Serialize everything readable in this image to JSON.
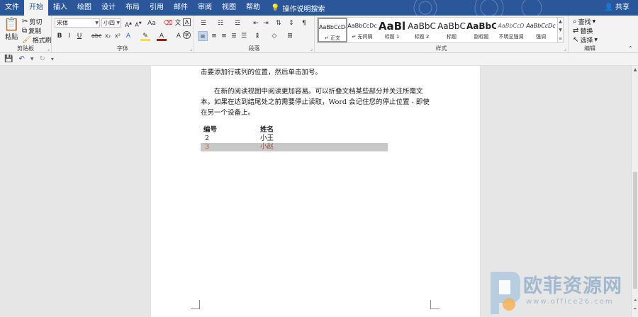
{
  "tabs": [
    {
      "label": "文件",
      "active": false
    },
    {
      "label": "开始",
      "active": true
    },
    {
      "label": "插入",
      "active": false
    },
    {
      "label": "绘图",
      "active": false
    },
    {
      "label": "设计",
      "active": false
    },
    {
      "label": "布局",
      "active": false
    },
    {
      "label": "引用",
      "active": false
    },
    {
      "label": "邮件",
      "active": false
    },
    {
      "label": "审阅",
      "active": false
    },
    {
      "label": "视图",
      "active": false
    },
    {
      "label": "帮助",
      "active": false
    }
  ],
  "tell_me": "操作说明搜索",
  "share": "共享",
  "clipboard": {
    "paste": "粘贴",
    "cut": "剪切",
    "copy": "复制",
    "format_painter": "格式刷",
    "label": "剪贴板"
  },
  "font": {
    "name": "宋体",
    "size": "小四",
    "label": "字体"
  },
  "paragraph": {
    "label": "段落"
  },
  "styles": {
    "label": "样式",
    "items": [
      {
        "preview": "AaBbCcDc",
        "name": "↵ 正文",
        "selected": true
      },
      {
        "preview": "AaBbCcDc",
        "name": "↵ 无间隔",
        "selected": false
      },
      {
        "preview": "AaBl",
        "name": "标题 1",
        "selected": false
      },
      {
        "preview": "AaBbC",
        "name": "标题 2",
        "selected": false
      },
      {
        "preview": "AaBbC",
        "name": "标题",
        "selected": false
      },
      {
        "preview": "AaBbC",
        "name": "副标题",
        "selected": false
      },
      {
        "preview": "AaBbCcD",
        "name": "不明显强调",
        "selected": false
      },
      {
        "preview": "AaBbCcDc",
        "name": "强调",
        "selected": false
      }
    ]
  },
  "editing": {
    "find": "查找",
    "replace": "替换",
    "select": "选择",
    "label": "编辑"
  },
  "document": {
    "line1": "击要添加行或列的位置，然后单击加号。",
    "para2": "在新的阅读视图中阅读更加容易。可以折叠文档某些部分并关注所需文本。如果在达到结尾处之前需要停止读取，Word 会记住您的停止位置 - 即使在另一个设备上。",
    "table": {
      "headers": [
        "编号",
        "姓名"
      ],
      "rows": [
        [
          "2",
          "小王"
        ],
        [
          "3",
          "小赵"
        ]
      ]
    }
  },
  "watermark": {
    "text": "欧菲资源网",
    "url": "www.office26.com"
  },
  "colors": {
    "accent": "#2b579a",
    "highlight_row": "#c8c8c8",
    "font_red": "#c0392b"
  }
}
